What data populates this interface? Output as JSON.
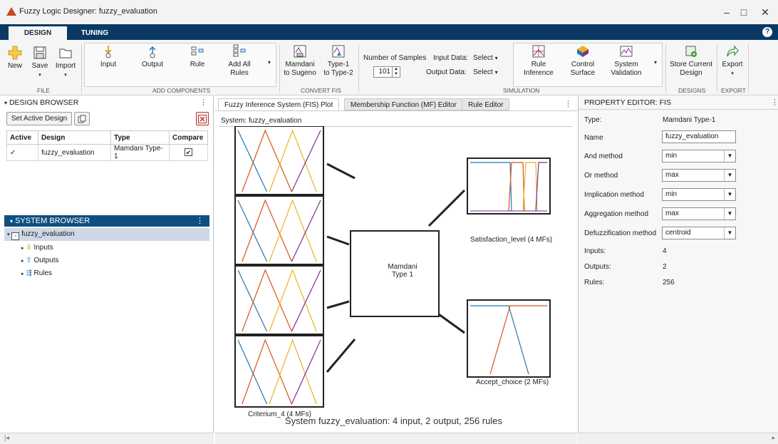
{
  "window": {
    "title": "Fuzzy Logic Designer: fuzzy_evaluation",
    "minimize": "–",
    "maximize": "□",
    "close": "✕"
  },
  "tabs": [
    {
      "label": "DESIGN"
    },
    {
      "label": "TUNING"
    }
  ],
  "help_label": "?",
  "ribbon": {
    "file": {
      "new": "New",
      "save": "Save",
      "import": "Import",
      "group": "FILE"
    },
    "add_components": {
      "input": "Input",
      "output": "Output",
      "rule": "Rule",
      "add_all_rules_1": "Add All",
      "add_all_rules_2": "Rules",
      "group": "ADD COMPONENTS"
    },
    "convert": {
      "mamdani_1": "Mamdani",
      "mamdani_2": "to Sugeno",
      "type1_1": "Type-1",
      "type1_2": "to Type-2",
      "group": "CONVERT FIS"
    },
    "simulation": {
      "num_samples_label": "Number of Samples",
      "num_samples_value": "101",
      "input_data_label": "Input Data:",
      "input_data_value": "Select",
      "output_data_label": "Output Data:",
      "output_data_value": "Select",
      "rule_inference_1": "Rule",
      "rule_inference_2": "Inference",
      "control_surface_1": "Control",
      "control_surface_2": "Surface",
      "system_validation_1": "System",
      "system_validation_2": "Validation",
      "group": "SIMULATION"
    },
    "designs": {
      "store_1": "Store Current",
      "store_2": "Design",
      "group": "DESIGNS"
    },
    "export": {
      "label": "Export",
      "group": "EXPORT"
    }
  },
  "design_browser": {
    "title": "DESIGN BROWSER",
    "set_active": "Set Active Design",
    "columns": [
      "Active",
      "Design",
      "Type",
      "Compare"
    ],
    "rows": [
      {
        "active": "✓",
        "design": "fuzzy_evaluation",
        "type": "Mamdani Type-1",
        "compare": "✔"
      }
    ]
  },
  "system_browser": {
    "title": "SYSTEM BROWSER",
    "root": "fuzzy_evaluation",
    "items": [
      {
        "label": "Inputs"
      },
      {
        "label": "Outputs"
      },
      {
        "label": "Rules"
      }
    ]
  },
  "center": {
    "tabs": [
      {
        "label": "Fuzzy Inference System (FIS) Plot"
      },
      {
        "label": "Membership Function (MF) Editor"
      },
      {
        "label": "Rule Editor"
      }
    ],
    "system_label": "System: fuzzy_evaluation",
    "fis_box_1": "Mamdani",
    "fis_box_2": "Type 1",
    "input_caption": "Criterium_4 (4 MFs)",
    "output1_caption": "Satisfaction_level (4 MFs)",
    "output2_caption": "Accept_choice (2 MFs)",
    "summary": "System fuzzy_evaluation: 4 input, 2 output, 256 rules",
    "mf_colors": [
      "#1f77b4",
      "#d95319",
      "#edb120",
      "#7e2f8e"
    ]
  },
  "property_editor": {
    "title": "PROPERTY EDITOR: FIS",
    "type_label": "Type:",
    "type_value": "Mamdani Type-1",
    "name_label": "Name",
    "name_value": "fuzzy_evaluation",
    "and_label": "And method",
    "and_value": "min",
    "or_label": "Or method",
    "or_value": "max",
    "imp_label": "Implication method",
    "imp_value": "min",
    "agg_label": "Aggregation method",
    "agg_value": "max",
    "defuzz_label": "Defuzzification method",
    "defuzz_value": "centroid",
    "inputs_label": "Inputs:",
    "inputs_value": "4",
    "outputs_label": "Outputs:",
    "outputs_value": "2",
    "rules_label": "Rules:",
    "rules_value": "256"
  }
}
